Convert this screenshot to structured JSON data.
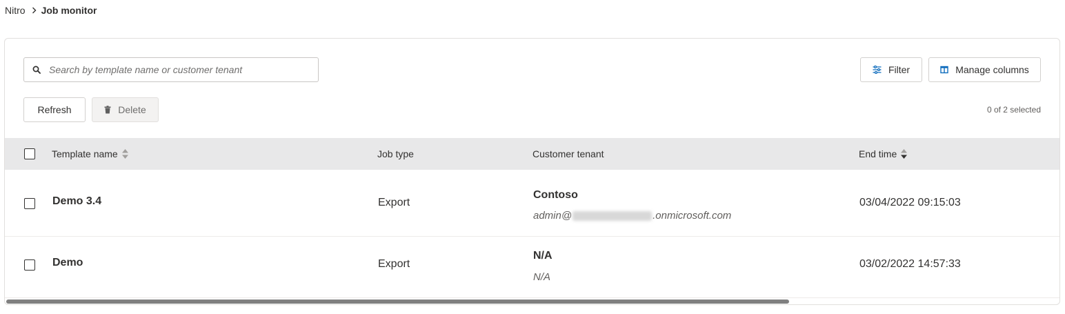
{
  "breadcrumb": {
    "root": "Nitro",
    "current": "Job monitor"
  },
  "search": {
    "placeholder": "Search by template name or customer tenant"
  },
  "toolbar": {
    "filter_label": "Filter",
    "manage_columns_label": "Manage columns",
    "refresh_label": "Refresh",
    "delete_label": "Delete",
    "selected_text": "0 of 2 selected"
  },
  "table": {
    "columns": {
      "template_name": "Template name",
      "job_type": "Job type",
      "customer_tenant": "Customer tenant",
      "end_time": "End time"
    },
    "rows": [
      {
        "template_name": "Demo 3.4",
        "job_type": "Export",
        "tenant_name": "Contoso",
        "tenant_email_prefix": "admin@",
        "tenant_email_suffix": ".onmicrosoft.com",
        "end_time": "03/04/2022 09:15:03"
      },
      {
        "template_name": "Demo",
        "job_type": "Export",
        "tenant_name": "N/A",
        "tenant_sub": "N/A",
        "end_time": "03/02/2022 14:57:33"
      }
    ]
  },
  "colors": {
    "accent": "#0f6cbd",
    "header_bg": "#e8e8e9",
    "text": "#323130"
  },
  "icons": {
    "search": "search-icon",
    "filter": "filter-icon",
    "columns": "columns-icon",
    "delete": "trash-icon",
    "sort": "sort-icon",
    "chevron": "chevron-right-icon"
  }
}
